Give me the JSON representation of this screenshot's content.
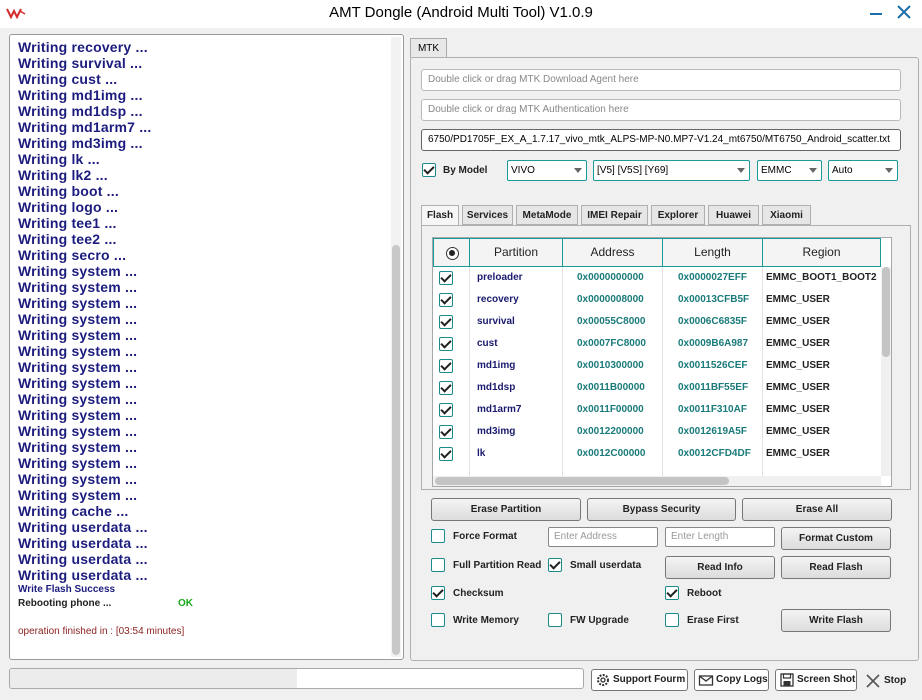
{
  "window": {
    "title": "AMT Dongle (Android Multi Tool) V1.0.9"
  },
  "log": {
    "lines": [
      "Writing recovery ...",
      "Writing survival ...",
      "Writing cust ...",
      "Writing md1img ...",
      "Writing md1dsp ...",
      "Writing md1arm7 ...",
      "Writing md3img ...",
      "Writing lk ...",
      "Writing lk2 ...",
      "Writing boot ...",
      "Writing logo ...",
      "Writing tee1 ...",
      "Writing tee2 ...",
      "Writing secro ...",
      "Writing system ...",
      "Writing system ...",
      "Writing system ...",
      "Writing system ...",
      "Writing system ...",
      "Writing system ...",
      "Writing system ...",
      "Writing system ...",
      "Writing system ...",
      "Writing system ...",
      "Writing system ...",
      "Writing system ...",
      "Writing system ...",
      "Writing system ...",
      "Writing system ...",
      "Writing cache ...",
      "Writing userdata ...",
      "Writing userdata ...",
      "Writing userdata ...",
      "Writing userdata ..."
    ],
    "success": "Write Flash Success",
    "rebooting": "Rebooting phone ...",
    "ok": "OK",
    "finished": "operation finished in : [03:54 minutes]"
  },
  "mtk_tab": "MTK",
  "inputs": {
    "download_agent": "Double click or drag MTK Download Agent here",
    "authentication": "Double click or drag MTK Authentication here",
    "scatter": "6750/PD1705F_EX_A_1.7.17_vivo_mtk_ALPS-MP-N0.MP7-V1.24_mt6750/MT6750_Android_scatter.txt"
  },
  "by_model": {
    "label": "By Model",
    "checked": true
  },
  "combos": {
    "brand": "VIVO",
    "model": "[V5] [V5S] [Y69]",
    "storage": "EMMC",
    "mode": "Auto"
  },
  "subtabs": [
    "Flash",
    "Services",
    "MetaMode",
    "IMEI Repair",
    "Explorer",
    "Huawei",
    "Xiaomi"
  ],
  "grid": {
    "headers": [
      "Partition",
      "Address",
      "Length",
      "Region"
    ],
    "rows": [
      {
        "partition": "preloader",
        "address": "0x0000000000",
        "length": "0x0000027EFF",
        "region": "EMMC_BOOT1_BOOT2"
      },
      {
        "partition": "recovery",
        "address": "0x0000008000",
        "length": "0x00013CFB5F",
        "region": "EMMC_USER"
      },
      {
        "partition": "survival",
        "address": "0x00055C8000",
        "length": "0x0006C6835F",
        "region": "EMMC_USER"
      },
      {
        "partition": "cust",
        "address": "0x0007FC8000",
        "length": "0x0009B6A987",
        "region": "EMMC_USER"
      },
      {
        "partition": "md1img",
        "address": "0x0010300000",
        "length": "0x0011526CEF",
        "region": "EMMC_USER"
      },
      {
        "partition": "md1dsp",
        "address": "0x0011B00000",
        "length": "0x0011BF55EF",
        "region": "EMMC_USER"
      },
      {
        "partition": "md1arm7",
        "address": "0x0011F00000",
        "length": "0x0011F310AF",
        "region": "EMMC_USER"
      },
      {
        "partition": "md3img",
        "address": "0x0012200000",
        "length": "0x0012619A5F",
        "region": "EMMC_USER"
      },
      {
        "partition": "lk",
        "address": "0x0012C00000",
        "length": "0x0012CFD4DF",
        "region": "EMMC_USER"
      }
    ]
  },
  "buttons": {
    "erase_partition": "Erase Partition",
    "bypass_security": "Bypass Security",
    "erase_all": "Erase All",
    "format_custom": "Format Custom",
    "read_info": "Read Info",
    "read_flash": "Read Flash",
    "write_flash": "Write Flash"
  },
  "fields": {
    "address_placeholder": "Enter Address",
    "length_placeholder": "Enter Length"
  },
  "options": {
    "force_format": "Force Format",
    "full_partition_read": "Full Partition Read",
    "small_userdata": "Small userdata",
    "checksum": "Checksum",
    "reboot": "Reboot",
    "write_memory": "Write Memory",
    "fw_upgrade": "FW Upgrade",
    "erase_first": "Erase First"
  },
  "bottom": {
    "progress_percent": 50,
    "support_forum": "Support Fourm",
    "copy_logs": "Copy Logs",
    "screen_shot": "Screen Shot",
    "stop": "Stop"
  },
  "colors": {
    "accent": "#1a9a9a",
    "log_text": "#1c1c7e",
    "ok": "#19a819"
  }
}
